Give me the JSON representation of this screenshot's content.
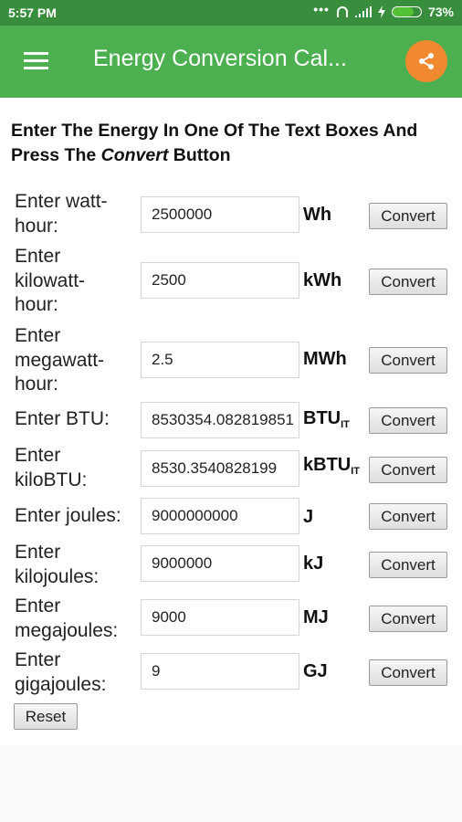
{
  "status_bar": {
    "time": "5:57 PM",
    "dots": "•••",
    "battery_percent_label": "73%",
    "battery_level": 0.73,
    "icons": [
      "more-icon",
      "headphones-icon",
      "signal-icon",
      "charging-icon",
      "battery-icon"
    ]
  },
  "app_bar": {
    "title": "Energy Conversion Cal...",
    "menu_icon": "hamburger-menu-icon",
    "share_icon": "share-icon",
    "share_color": "#f0892f",
    "bar_color": "#4caf50",
    "status_color": "#388e3c"
  },
  "instructions": {
    "part1": "Enter The Energy In One Of The Text Boxes And Press The ",
    "italic": "Convert",
    "part2": " Button"
  },
  "rows": [
    {
      "label": "Enter watt-hour:",
      "value": "2500000",
      "unit": "Wh",
      "unit_sub": "",
      "button": "Convert"
    },
    {
      "label": "Enter kilowatt-hour:",
      "value": "2500",
      "unit": "kWh",
      "unit_sub": "",
      "button": "Convert"
    },
    {
      "label": "Enter megawatt-hour:",
      "value": "2.5",
      "unit": "MWh",
      "unit_sub": "",
      "button": "Convert"
    },
    {
      "label": "Enter BTU:",
      "value": "8530354.082819851",
      "unit": "BTU",
      "unit_sub": "IT",
      "button": "Convert"
    },
    {
      "label": "Enter kiloBTU:",
      "value": "8530.3540828199",
      "unit": "kBTU",
      "unit_sub": "IT",
      "button": "Convert"
    },
    {
      "label": "Enter joules:",
      "value": "9000000000",
      "unit": "J",
      "unit_sub": "",
      "button": "Convert"
    },
    {
      "label": "Enter kilojoules:",
      "value": "9000000",
      "unit": "kJ",
      "unit_sub": "",
      "button": "Convert"
    },
    {
      "label": "Enter megajoules:",
      "value": "9000",
      "unit": "MJ",
      "unit_sub": "",
      "button": "Convert"
    },
    {
      "label": "Enter gigajoules:",
      "value": "9",
      "unit": "GJ",
      "unit_sub": "",
      "button": "Convert"
    }
  ],
  "reset_label": "Reset"
}
